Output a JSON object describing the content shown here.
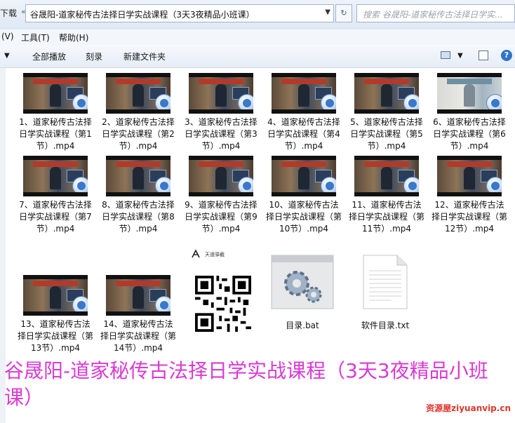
{
  "address": {
    "left_fragment": "下载",
    "path": "谷晟阳-道家秘传古法择日学实战课程（3天3夜精品小班课）",
    "search_placeholder": "搜索 谷晟阳-道家秘传古法择日学实..."
  },
  "menu": {
    "items": [
      "(V)",
      "工具(T)",
      "帮助(H)"
    ]
  },
  "toolbar": {
    "play_all": "全部播放",
    "burn": "刻录",
    "new_folder": "新建文件夹"
  },
  "files": [
    {
      "label": "1、道家秘传古法择日学实战课程（第1节）.mp4",
      "type": "video",
      "thumb": "dark"
    },
    {
      "label": "2、道家秘传古法择日学实战课程（第2节）.mp4",
      "type": "video",
      "thumb": "dark"
    },
    {
      "label": "3、道家秘传古法择日学实战课程（第3节）.mp4",
      "type": "video",
      "thumb": "dark"
    },
    {
      "label": "4、道家秘传古法择日学实战课程（第4节）.mp4",
      "type": "video",
      "thumb": "dark"
    },
    {
      "label": "5、道家秘传古法择日学实战课程（第5节）.mp4",
      "type": "video",
      "thumb": "dark"
    },
    {
      "label": "6、道家秘传古法择日学实战课程（第6节）.mp4",
      "type": "video",
      "thumb": "light"
    },
    {
      "label": "7、道家秘传古法择日学实战课程（第7节）.mp4",
      "type": "video",
      "thumb": "dark"
    },
    {
      "label": "8、道家秘传古法择日学实战课程（第8节）.mp4",
      "type": "video",
      "thumb": "dark"
    },
    {
      "label": "9、道家秘传古法择日学实战课程（第9节）.mp4",
      "type": "video",
      "thumb": "dark"
    },
    {
      "label": "10、道家秘传古法择日学实战课程（第10节）.mp4",
      "type": "video",
      "thumb": "dark"
    },
    {
      "label": "11、道家秘传古法择日学实战课程（第11节）.mp4",
      "type": "video",
      "thumb": "dark"
    },
    {
      "label": "12、道家秘传古法择日学实战课程（第12节）.mp4",
      "type": "video",
      "thumb": "dark"
    },
    {
      "label": "13、道家秘传古法择日学实战课程（第13节）.mp4",
      "type": "video",
      "thumb": "dark"
    },
    {
      "label": "14、道家秘传古法择日学实战课程（第14节）.mp4",
      "type": "video",
      "thumb": "dark"
    },
    {
      "label": "",
      "type": "qr",
      "qr_title": "天道驿截"
    },
    {
      "label": "目录.bat",
      "type": "bat"
    },
    {
      "label": "软件目录.txt",
      "type": "txt"
    }
  ],
  "overlay_title": "谷晟阳-道家秘传古法择日学实战课程（3天3夜精品小班课）",
  "watermark": "资源屋ziyuanvip.cn",
  "colors": {
    "overlay_text": "#d93ad6",
    "watermark": "#e0352b",
    "chrome_bg": "#dfe8f4"
  }
}
